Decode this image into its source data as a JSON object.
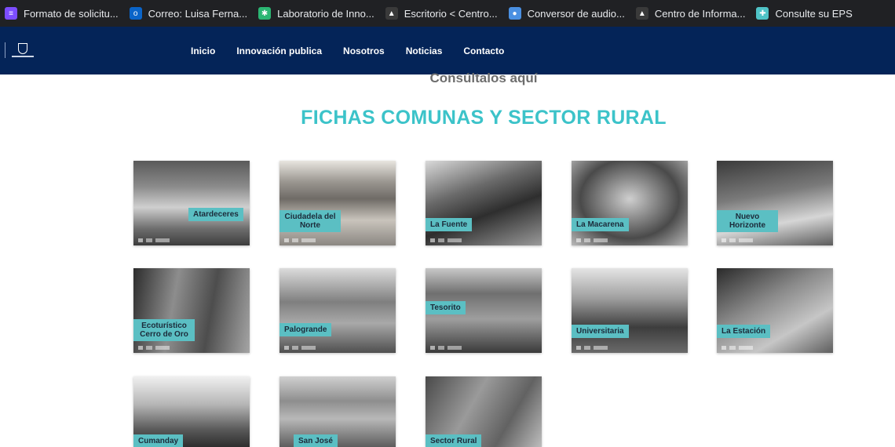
{
  "bookmarks": [
    {
      "label": "Formato de solicitu...",
      "icon": "form-icon",
      "color": "#7c4dff",
      "glyph": "≡"
    },
    {
      "label": "Correo: Luisa Ferna...",
      "icon": "outlook-icon",
      "color": "#0a64c8",
      "glyph": "o"
    },
    {
      "label": "Laboratorio de Inno...",
      "icon": "lab-icon",
      "color": "#2bb673",
      "glyph": "✱"
    },
    {
      "label": "Escritorio < Centro...",
      "icon": "wordpress-icon",
      "color": "#3a3a3a",
      "glyph": "▲"
    },
    {
      "label": "Conversor de audio...",
      "icon": "converter-icon",
      "color": "#4a90e2",
      "glyph": "●"
    },
    {
      "label": "Centro de Informa...",
      "icon": "info-center-icon",
      "color": "#3a3a3a",
      "glyph": "▲"
    },
    {
      "label": "Consulte su EPS",
      "icon": "plus-icon",
      "color": "#4fc3c7",
      "glyph": "✚"
    }
  ],
  "nav": [
    "Inicio",
    "Innovación publica",
    "Nosotros",
    "Noticias",
    "Contacto"
  ],
  "sub_heading": "Consúltalos aquí",
  "title": "FICHAS COMUNAS Y SECTOR RURAL",
  "cards": [
    {
      "label": "Atardeceres",
      "photo": "linear-gradient(180deg,#5a5a5a 0%,#8a8a8a 30%,#cfcfcf 55%,#6e6e6e 80%,#3d3d3d 100%)"
    },
    {
      "label": "Ciudadela del Norte",
      "photo": "linear-gradient(180deg,#e8e5df 0%,#9a9690 25%,#6f6b66 45%,#c9c4bc 70%,#8b8782 100%)"
    },
    {
      "label": "La Fuente",
      "photo": "linear-gradient(160deg,#d9d9d9 0%,#6a6a6a 35%,#2e2e2e 60%,#9a9a9a 100%)"
    },
    {
      "label": "La Macarena",
      "photo": "radial-gradient(ellipse at 50% 45%,#cfcfcf 0%,#8c8c8c 30%,#4a4a4a 60%,#b9b9b9 100%)"
    },
    {
      "label": "Nuevo Horizonte",
      "photo": "linear-gradient(170deg,#3a3a3a 0%,#7a7a7a 40%,#d6d6d6 70%,#5c5c5c 100%)"
    },
    {
      "label": "Ecoturístico Cerro de Oro",
      "photo": "linear-gradient(100deg,#2c2c2c 0%,#8d8d8d 35%,#4d4d4d 65%,#a5a5a5 100%)"
    },
    {
      "label": "Palogrande",
      "photo": "linear-gradient(180deg,#dcdcdc 0%,#7f7f7f 40%,#a9a9a9 65%,#4f4f4f 100%)"
    },
    {
      "label": "Tesorito",
      "photo": "linear-gradient(180deg,#c8c8c8 0%,#6f6f6f 30%,#9e9e9e 60%,#3a3a3a 100%)"
    },
    {
      "label": "Universitaria",
      "photo": "linear-gradient(180deg,#e5e5e5 0%,#a0a0a0 35%,#3d3d3d 70%,#6a6a6a 100%)"
    },
    {
      "label": "La Estación",
      "photo": "linear-gradient(150deg,#2a2a2a 0%,#8a8a8a 40%,#c6c6c6 70%,#5e5e5e 100%)"
    },
    {
      "label": "Cumanday",
      "photo": "linear-gradient(180deg,#f0f0f0 0%,#b5b5b5 40%,#5a5a5a 75%,#2e2e2e 100%)"
    },
    {
      "label": "San José",
      "photo": "linear-gradient(180deg,#d0d0d0 0%,#8e8e8e 35%,#b8b8b8 60%,#5d5d5d 100%)"
    },
    {
      "label": "Sector Rural",
      "photo": "linear-gradient(120deg,#4a4a4a 0%,#9a9a9a 40%,#626262 70%,#bdbdbd 100%)"
    }
  ]
}
